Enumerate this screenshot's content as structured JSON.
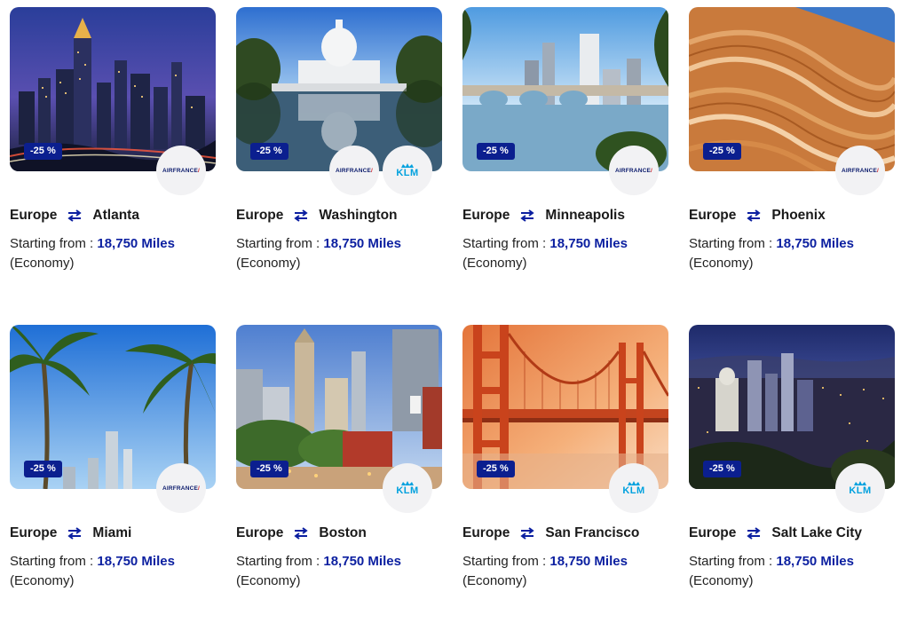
{
  "colors": {
    "accent": "#0b1fa0",
    "badge_bg": "#0b1f8f",
    "klm": "#00a1de",
    "af_red": "#d2232a"
  },
  "common": {
    "origin": "Europe",
    "starting_label": "Starting from : ",
    "cabin": "(Economy)",
    "af_logo_text": "AIRFRANCE",
    "af_logo_slash": "/",
    "klm_logo_text": "KLM"
  },
  "cards": [
    {
      "destination": "Atlanta",
      "discount": "-25 %",
      "miles": "18,750 Miles",
      "airlines": [
        "airfrance"
      ],
      "scene": "city-night"
    },
    {
      "destination": "Washington",
      "discount": "-25 %",
      "miles": "18,750 Miles",
      "airlines": [
        "airfrance",
        "klm"
      ],
      "scene": "capitol"
    },
    {
      "destination": "Minneapolis",
      "discount": "-25 %",
      "miles": "18,750 Miles",
      "airlines": [
        "airfrance"
      ],
      "scene": "bridge-city"
    },
    {
      "destination": "Phoenix",
      "discount": "-25 %",
      "miles": "18,750 Miles",
      "airlines": [
        "airfrance"
      ],
      "scene": "sandstone"
    },
    {
      "destination": "Miami",
      "discount": "-25 %",
      "miles": "18,750 Miles",
      "airlines": [
        "airfrance"
      ],
      "scene": "palms"
    },
    {
      "destination": "Boston",
      "discount": "-25 %",
      "miles": "18,750 Miles",
      "airlines": [
        "klm"
      ],
      "scene": "old-town"
    },
    {
      "destination": "San Francisco",
      "discount": "-25 %",
      "miles": "18,750 Miles",
      "airlines": [
        "klm"
      ],
      "scene": "golden-gate"
    },
    {
      "destination": "Salt Lake City",
      "discount": "-25 %",
      "miles": "18,750 Miles",
      "airlines": [
        "klm"
      ],
      "scene": "night-valley"
    }
  ]
}
